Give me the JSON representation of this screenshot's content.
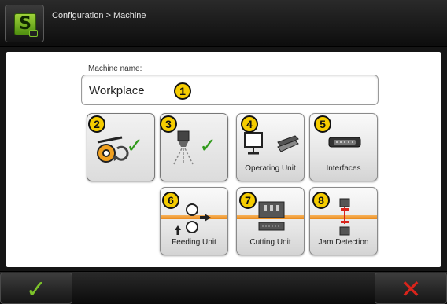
{
  "header": {
    "breadcrumb": "Configuration > Machine",
    "logo_text": "S"
  },
  "machine_name": {
    "label": "Machine name:",
    "value": "Workplace",
    "marker": "1"
  },
  "tiles": [
    {
      "id": "feed-drive",
      "marker": "2",
      "label": "",
      "checked": true,
      "icon": "feed-roll-icon"
    },
    {
      "id": "sensor",
      "marker": "3",
      "label": "",
      "checked": true,
      "icon": "sensor-icon"
    },
    {
      "id": "operating-unit",
      "marker": "4",
      "label": "Operating Unit",
      "icon": "monitor-tray-icon"
    },
    {
      "id": "interfaces",
      "marker": "5",
      "label": "Interfaces",
      "icon": "serial-port-icon"
    },
    {
      "id": "feeding-unit",
      "marker": "6",
      "label": "Feeding Unit",
      "icon": "feeding-rollers-icon"
    },
    {
      "id": "cutting-unit",
      "marker": "7",
      "label": "Cutting Unit",
      "icon": "cutter-icon"
    },
    {
      "id": "jam-detection",
      "marker": "8",
      "label": "Jam Detection",
      "icon": "jam-sensor-icon"
    }
  ],
  "footer": {
    "confirm_glyph": "✓",
    "cancel_glyph": "✕"
  },
  "colors": {
    "accent_green": "#7cc22a",
    "marker_yellow": "#f5cc00",
    "stripe_orange": "#e98a1c",
    "cancel_red": "#d9241b"
  }
}
